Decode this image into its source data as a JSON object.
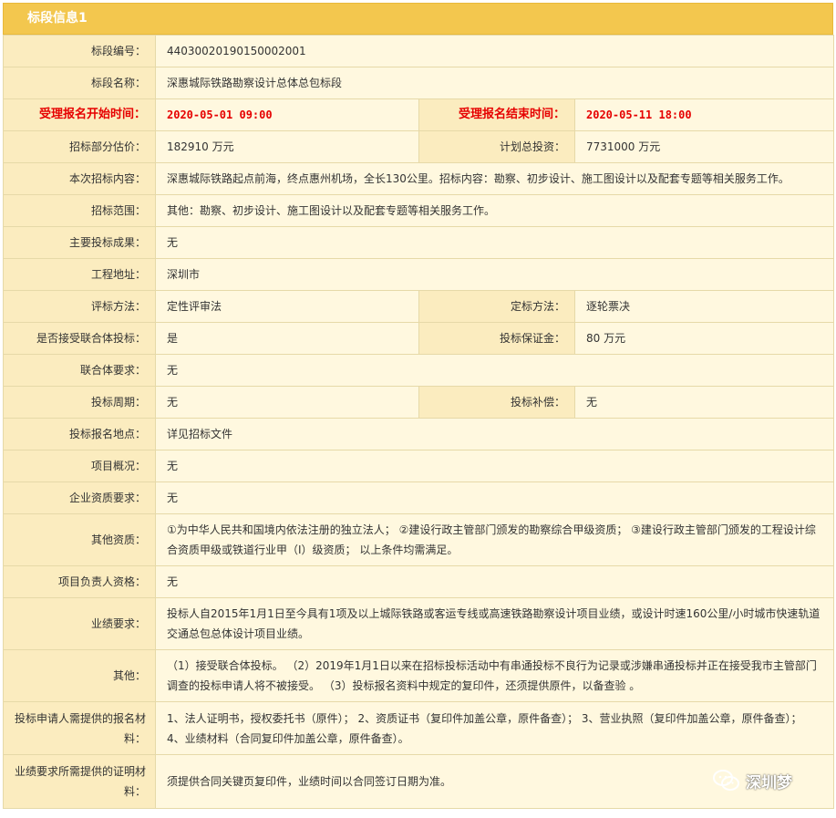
{
  "section_title": "标段信息1",
  "rows": {
    "bid_no": {
      "label": "标段编号：",
      "value": "44030020190150002001"
    },
    "bid_name": {
      "label": "标段名称：",
      "value": "深惠城际铁路勘察设计总体总包标段"
    },
    "reg_start": {
      "label": "受理报名开始时间：",
      "value": "2020-05-01 09:00"
    },
    "reg_end": {
      "label": "受理报名结束时间：",
      "value": "2020-05-11 18:00"
    },
    "est_price": {
      "label": "招标部分估价：",
      "value": "182910 万元"
    },
    "total_invest": {
      "label": "计划总投资：",
      "value": "7731000 万元"
    },
    "content": {
      "label": "本次招标内容：",
      "value": "深惠城际铁路起点前海，终点惠州机场，全长130公里。招标内容：勘察、初步设计、施工图设计以及配套专题等相关服务工作。"
    },
    "scope": {
      "label": "招标范围：",
      "value": "其他：勘察、初步设计、施工图设计以及配套专题等相关服务工作。"
    },
    "results": {
      "label": "主要投标成果：",
      "value": "无"
    },
    "location": {
      "label": "工程地址：",
      "value": "深圳市"
    },
    "eval_method": {
      "label": "评标方法：",
      "value": "定性评审法"
    },
    "award_method": {
      "label": "定标方法：",
      "value": "逐轮票决"
    },
    "consortium": {
      "label": "是否接受联合体投标：",
      "value": "是"
    },
    "bond": {
      "label": "投标保证金：",
      "value": "80 万元"
    },
    "consortium_req": {
      "label": "联合体要求：",
      "value": "无"
    },
    "period": {
      "label": "投标周期：",
      "value": "无"
    },
    "compensation": {
      "label": "投标补偿：",
      "value": "无"
    },
    "reg_place": {
      "label": "投标报名地点：",
      "value": "详见招标文件"
    },
    "overview": {
      "label": "项目概况：",
      "value": "无"
    },
    "qualification": {
      "label": "企业资质要求：",
      "value": "无"
    },
    "other_qual": {
      "label": "其他资质：",
      "value": "①为中华人民共和国境内依法注册的独立法人；  ②建设行政主管部门颁发的勘察综合甲级资质；  ③建设行政主管部门颁发的工程设计综合资质甲级或铁道行业甲（I）级资质；  以上条件均需满足。"
    },
    "pm_qual": {
      "label": "项目负责人资格：",
      "value": "无"
    },
    "performance": {
      "label": "业绩要求：",
      "value": "投标人自2015年1月1日至今具有1项及以上城际铁路或客运专线或高速铁路勘察设计项目业绩，或设计时速160公里/小时城市快速轨道交通总包总体设计项目业绩。"
    },
    "other": {
      "label": "其他：",
      "value": "（1）接受联合体投标。  （2）2019年1月1日以来在招标投标活动中有串通投标不良行为记录或涉嫌串通投标并正在接受我市主管部门调查的投标申请人将不被接受。  （3）投标报名资料中规定的复印件，还须提供原件，以备查验 。"
    },
    "reg_materials": {
      "label": "投标申请人需提供的报名材料：",
      "value": "1、法人证明书，授权委托书（原件）；  2、资质证书（复印件加盖公章，原件备查）；  3、营业执照（复印件加盖公章，原件备查）；  4、业绩材料（合同复印件加盖公章，原件备查）。"
    },
    "proof_materials": {
      "label": "业绩要求所需提供的证明材料：",
      "value": "须提供合同关键页复印件，业绩时间以合同签订日期为准。"
    }
  },
  "watermark": {
    "text": "深圳梦",
    "icon": "wechat-icon"
  }
}
